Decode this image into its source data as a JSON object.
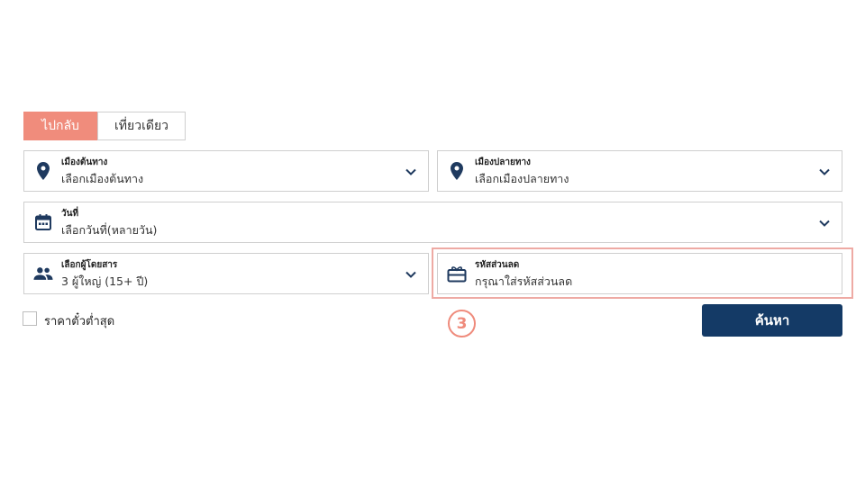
{
  "trip_tabs": {
    "round_trip": "ไปกลับ",
    "one_way": "เที่ยวเดียว"
  },
  "origin": {
    "label": "เมืองต้นทาง",
    "placeholder": "เลือกเมืองต้นทาง",
    "icon": "location-pin-icon"
  },
  "destination": {
    "label": "เมืองปลายทาง",
    "placeholder": "เลือกเมืองปลายทาง",
    "icon": "location-pin-icon"
  },
  "date": {
    "label": "วันที่",
    "placeholder": "เลือกวันที่(หลายวัน)",
    "icon": "calendar-icon"
  },
  "passengers": {
    "label": "เลือกผู้โดยสาร",
    "value": "3 ผู้ใหญ่ (15+ ปี)",
    "icon": "people-icon"
  },
  "promo": {
    "label": "รหัสส่วนลด",
    "placeholder": "กรุณาใส่รหัสส่วนลด",
    "icon": "gift-card-icon"
  },
  "lowest_fare": {
    "label": "ราคาตั๋วต่ำสุด"
  },
  "step_marker": "3",
  "search_button": "ค้นหา",
  "colors": {
    "accent": "#f08c7c",
    "primary": "#143a66",
    "icon": "#1f3a5f",
    "highlight": "#eeaaa4"
  }
}
